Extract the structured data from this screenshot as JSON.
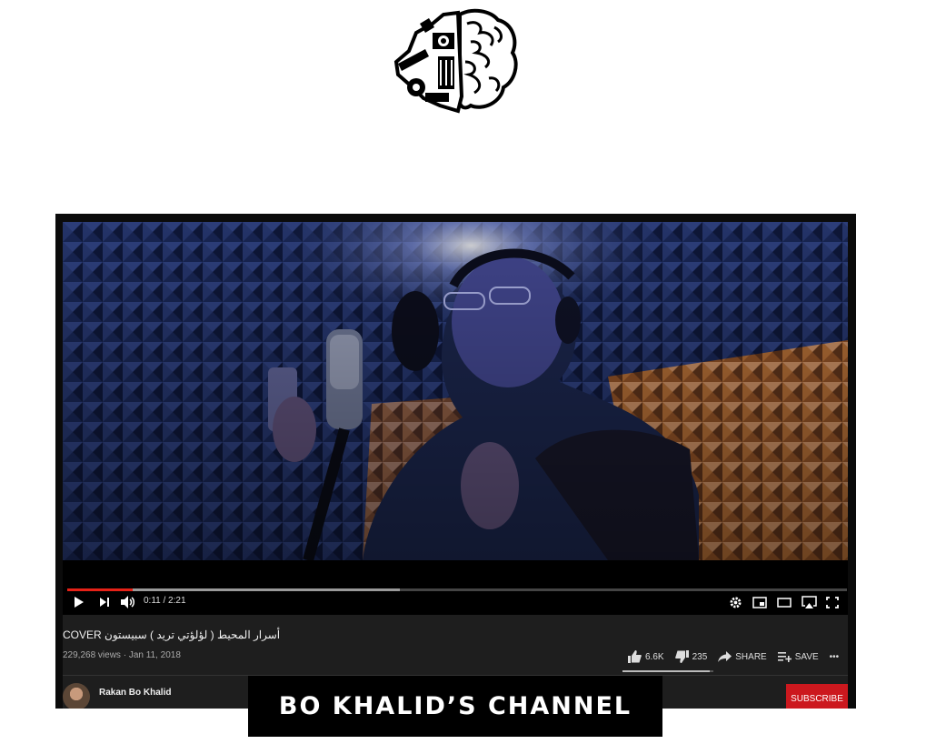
{
  "banner": {
    "title": "BO KHALID’S CHANNEL"
  },
  "player": {
    "time": "0:11 / 2:21",
    "progress": {
      "played_fraction": 0.084,
      "buffered_fraction": 0.426
    }
  },
  "video": {
    "title": "COVER أسرار المحيط ( لؤلؤتي تريد ) سبيستون",
    "meta": "229,268 views · Jan 11, 2018"
  },
  "actions": {
    "likes": "6.6K",
    "dislikes": "235",
    "share": "SHARE",
    "save": "SAVE",
    "more": "•••"
  },
  "channel": {
    "name": "Rakan Bo Khalid"
  },
  "subscribe_label": "SUBSCRIBE",
  "colors": {
    "progress": "#e62117",
    "subscribe": "#cc181e",
    "banner_bg": "#000000"
  },
  "icons": [
    "brain-logo-icon",
    "play-icon",
    "next-icon",
    "volume-icon",
    "settings-icon",
    "miniplayer-icon",
    "theater-icon",
    "airplay-icon",
    "fullscreen-icon",
    "thumbs-up-icon",
    "thumbs-down-icon",
    "share-icon",
    "save-playlist-icon",
    "more-icon"
  ]
}
